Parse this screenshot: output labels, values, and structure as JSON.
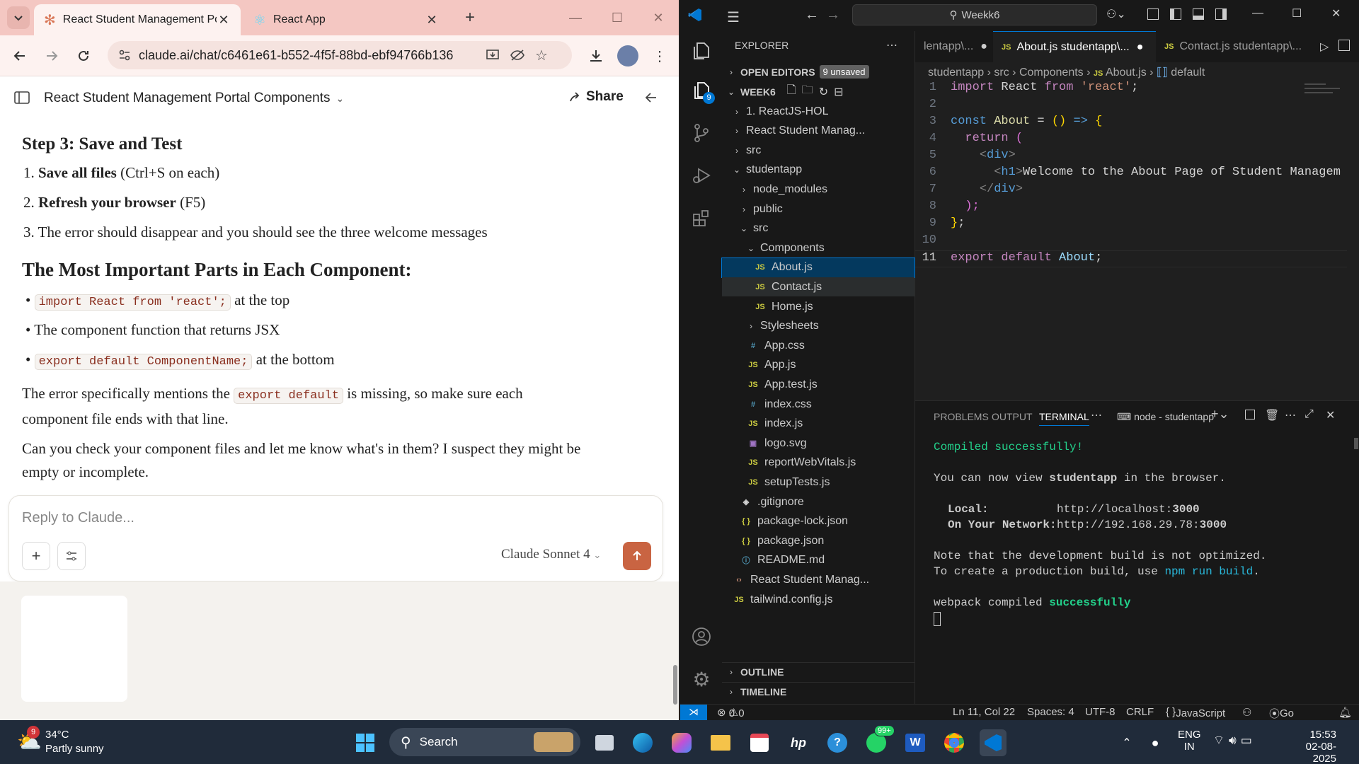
{
  "browser": {
    "tabs": [
      {
        "label": "React Student Management Po"
      },
      {
        "label": "React App"
      }
    ],
    "url": "claude.ai/chat/c6461e61-b552-4f5f-88bd-ebf94766b136"
  },
  "claude": {
    "conversation_title": "React Student Management Portal Components",
    "share_label": "Share",
    "step3_heading": "Step 3: Save and Test",
    "steps": [
      {
        "num": "1.",
        "bold": "Save all files",
        "rest": " (Ctrl+S on each)"
      },
      {
        "num": "2.",
        "bold": "Refresh your browser",
        "rest": " (F5)"
      },
      {
        "num": "3.",
        "bold": "",
        "rest": "The error should disappear and you should see the three welcome messages"
      }
    ],
    "parts_heading": "The Most Important Parts in Each Component:",
    "parts": {
      "b1_code": "import React from 'react';",
      "b1_text": " at the top",
      "b2_text": "The component function that returns JSX",
      "b3_code": "export default ComponentName;",
      "b3_text": " at the bottom"
    },
    "para1": {
      "pre": "The error specifically mentions the ",
      "code": "export default",
      "post": " is missing, so make sure each",
      "line2": "component file ends with that line."
    },
    "para2": {
      "line1": "Can you check your component files and let me know what's in them? I suspect they might be",
      "line2": "empty or incomplete."
    },
    "reply_placeholder": "Reply to Claude...",
    "model": "Claude Sonnet 4"
  },
  "vscode": {
    "search": "Weekk6",
    "explorer_title": "EXPLORER",
    "open_editors": "OPEN EDITORS",
    "unsaved_badge": "9 unsaved",
    "workspace": "WEEK6",
    "scm_badge": "9",
    "tree": [
      {
        "label": "1. ReactJS-HOL",
        "type": "folder",
        "indent": 0
      },
      {
        "label": "React Student Manag...",
        "type": "folder",
        "indent": 0
      },
      {
        "label": "src",
        "type": "folder",
        "indent": 0
      },
      {
        "label": "studentapp",
        "type": "folder-open",
        "indent": 0
      },
      {
        "label": "node_modules",
        "type": "folder",
        "indent": 1
      },
      {
        "label": "public",
        "type": "folder",
        "indent": 1
      },
      {
        "label": "src",
        "type": "folder-open",
        "indent": 1
      },
      {
        "label": "Components",
        "type": "folder-open",
        "indent": 2
      },
      {
        "label": "About.js",
        "type": "js",
        "indent": 3
      },
      {
        "label": "Contact.js",
        "type": "js",
        "indent": 3
      },
      {
        "label": "Home.js",
        "type": "js",
        "indent": 3
      },
      {
        "label": "Stylesheets",
        "type": "folder",
        "indent": 2
      },
      {
        "label": "App.css",
        "type": "css",
        "indent": 2
      },
      {
        "label": "App.js",
        "type": "js",
        "indent": 2
      },
      {
        "label": "App.test.js",
        "type": "js",
        "indent": 2
      },
      {
        "label": "index.css",
        "type": "css",
        "indent": 2
      },
      {
        "label": "index.js",
        "type": "js",
        "indent": 2
      },
      {
        "label": "logo.svg",
        "type": "svg",
        "indent": 2
      },
      {
        "label": "reportWebVitals.js",
        "type": "js",
        "indent": 2
      },
      {
        "label": "setupTests.js",
        "type": "js",
        "indent": 2
      },
      {
        "label": ".gitignore",
        "type": "git",
        "indent": 1
      },
      {
        "label": "package-lock.json",
        "type": "json",
        "indent": 1
      },
      {
        "label": "package.json",
        "type": "json",
        "indent": 1
      },
      {
        "label": "README.md",
        "type": "md",
        "indent": 1
      },
      {
        "label": "React Student Manag...",
        "type": "html",
        "indent": 0
      },
      {
        "label": "tailwind.config.js",
        "type": "js",
        "indent": 0
      }
    ],
    "outline": "OUTLINE",
    "timeline": "TIMELINE",
    "editor_tabs": [
      {
        "label": "lentapp\\..."
      },
      {
        "label": "About.js studentapp\\..."
      },
      {
        "label": "Contact.js studentapp\\..."
      }
    ],
    "breadcrumb": [
      "studentapp",
      "src",
      "Components",
      "About.js",
      "default"
    ],
    "code_numbers": [
      "1",
      "2",
      "3",
      "4",
      "5",
      "6",
      "7",
      "8",
      "9",
      "10",
      "11"
    ],
    "code_text": {
      "l1a": "import",
      "l1b": " React ",
      "l1c": "from",
      "l1d": " 'react'",
      "l1e": ";",
      "l3a": "const",
      "l3b": " About",
      "l3c": " = ",
      "l3d": "()",
      "l3e": " => ",
      "l3f": "{",
      "l4a": "return",
      "l4b": " (",
      "l5a": "<",
      "l5b": "div",
      "l5c": ">",
      "l6a": "<",
      "l6b": "h1",
      "l6c": ">",
      "l6d": "Welcome to the About Page of Student Managem",
      "l7a": "</",
      "l7b": "div",
      "l7c": ">",
      "l8a": ");",
      "l9a": "}",
      "l9b": ";",
      "l11a": "export",
      "l11b": " default",
      "l11c": " About",
      "l11d": ";"
    },
    "panel_tabs": [
      "PROBLEMS",
      "OUTPUT",
      "TERMINAL"
    ],
    "terminal_name": "node - studentapp",
    "terminal": {
      "compiled": "Compiled successfully!",
      "view_pre": "You can now view ",
      "view_app": "studentapp",
      "view_post": " in the browser.",
      "local_label": "Local:",
      "local_url": "http://localhost:",
      "local_port": "3000",
      "net_label": "On Your Network:",
      "net_url": "http://192.168.29.78:",
      "net_port": "3000",
      "note1": "Note that the development build is not optimized.",
      "note2_pre": "To create a production build, use ",
      "note2_cmd": "npm run build",
      "note2_post": ".",
      "webpack_pre": "webpack compiled ",
      "webpack_ok": "successfully"
    },
    "status": {
      "errors": "0",
      "warnings": "0",
      "position": "Ln 11, Col 22",
      "spaces": "Spaces: 4",
      "encoding": "UTF-8",
      "eol": "CRLF",
      "language": "JavaScript",
      "golive": "Go Live"
    }
  },
  "taskbar": {
    "weather_temp": "34°C",
    "weather_desc": "Partly sunny",
    "weather_badge": "9",
    "search": "Search",
    "whatsapp_badge": "99+",
    "lang1": "ENG",
    "lang2": "IN",
    "time": "15:53",
    "date": "02-08-2025"
  },
  "colors": {
    "claude_send": "#c96442",
    "vscode_accent": "#0078d4",
    "terminal_success": "#23d18b",
    "js_icon": "#cbcb41"
  }
}
